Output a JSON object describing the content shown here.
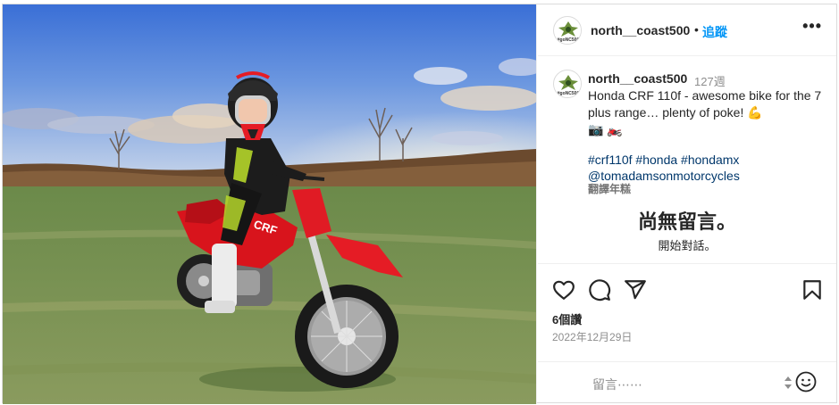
{
  "post": {
    "username": "north__coast500",
    "separator": "•",
    "follow_label": "追蹤",
    "more_label": "•••",
    "avatar_text": "#goNC500",
    "caption": {
      "username": "north__coast500",
      "age": "127週",
      "text": "Honda CRF 110f - awesome bike for the 7 plus range… plenty of poke! 💪",
      "emojis": "📷 🏍️",
      "hashtags": "#crf110f #honda #hondamx",
      "mention": "@tomadamsonmotorcycles",
      "translate_label": "翻譯年糕"
    },
    "empty_comments": {
      "title": "尚無留言。",
      "subtitle": "開始對話。"
    },
    "actions": {
      "like_icon": "heart-icon",
      "comment_icon": "comment-icon",
      "share_icon": "send-icon",
      "save_icon": "bookmark-icon"
    },
    "likes": "6個讚",
    "date": "2022年12月29日",
    "comment_placeholder": "留言⋯⋯"
  }
}
